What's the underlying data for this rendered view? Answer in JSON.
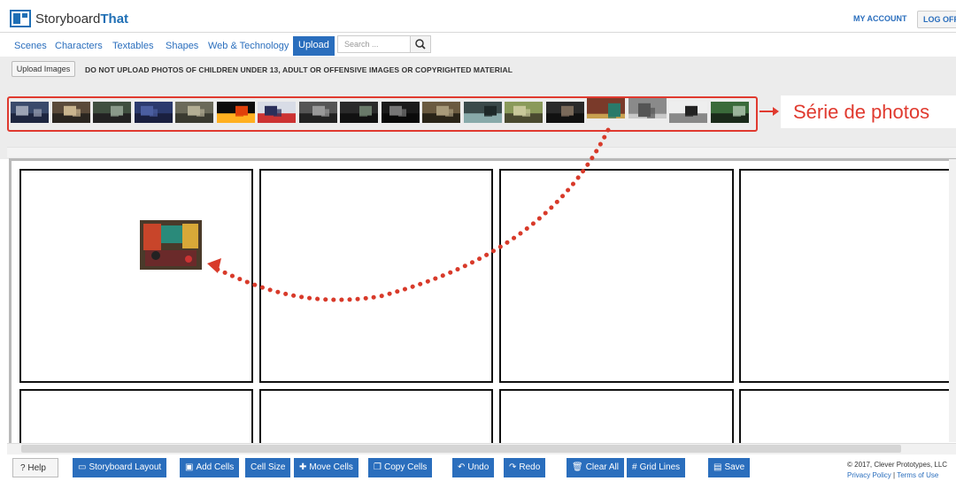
{
  "brand": {
    "name_part1": "Storyboard",
    "name_part2": "That"
  },
  "header": {
    "my_account": "MY ACCOUNT",
    "log_off": "LOG OFF"
  },
  "tabs": [
    {
      "label": "Scenes"
    },
    {
      "label": "Characters"
    },
    {
      "label": "Textables"
    },
    {
      "label": "Shapes"
    },
    {
      "label": "Web & Technology"
    },
    {
      "label": "Upload",
      "active": true
    }
  ],
  "search": {
    "placeholder": "Search ..."
  },
  "upload": {
    "button_label": "Upload Images",
    "warning": "DO NOT UPLOAD PHOTOS OF CHILDREN UNDER 13, ADULT OR OFFENSIVE IMAGES OR COPYRIGHTED MATERIAL"
  },
  "thumbnails": [
    {
      "colors": [
        "#3a4a6b",
        "#9ca3b5",
        "#1e2640"
      ]
    },
    {
      "colors": [
        "#5a4a3a",
        "#c9b48e",
        "#2a2520"
      ]
    },
    {
      "colors": [
        "#3f4f3f",
        "#8a9a8a",
        "#222"
      ]
    },
    {
      "colors": [
        "#2b3a6e",
        "#4b5ea0",
        "#1a2040"
      ]
    },
    {
      "colors": [
        "#6b6a5a",
        "#b3ae94",
        "#3a3a30"
      ]
    },
    {
      "colors": [
        "#0c0c0c",
        "#e0400a",
        "#ffb020"
      ]
    },
    {
      "colors": [
        "#d8dce6",
        "#2b2f5a",
        "#c33"
      ]
    },
    {
      "colors": [
        "#555",
        "#999",
        "#222"
      ]
    },
    {
      "colors": [
        "#2a2a2a",
        "#6a7a6a",
        "#111"
      ]
    },
    {
      "colors": [
        "#1b1b1b",
        "#777",
        "#0a0a0a"
      ]
    },
    {
      "colors": [
        "#6a5a40",
        "#a89a7a",
        "#2a2418"
      ]
    },
    {
      "colors": [
        "#3a4a4a",
        "#1e2a2a",
        "#8aa"
      ]
    },
    {
      "colors": [
        "#8a9a5a",
        "#c8c89a",
        "#4a4a30"
      ]
    },
    {
      "colors": [
        "#2a2a2a",
        "#7a6a5a",
        "#111"
      ]
    },
    {
      "colors": [
        "#7a3a2a",
        "#2a7a6a",
        "#c8a050"
      ]
    },
    {
      "colors": [
        "#8a8a8a",
        "#555",
        "#c8c8c8"
      ]
    },
    {
      "colors": [
        "#eee",
        "#222",
        "#888"
      ]
    },
    {
      "colors": [
        "#3a6a3a",
        "#9ab59a",
        "#1a2a1a"
      ]
    }
  ],
  "callout": {
    "text": "Série de photos",
    "color": "#e03a2f"
  },
  "toolbar": {
    "help": "Help",
    "storyboard_layout": "Storyboard Layout",
    "add_cells": "Add Cells",
    "cell_size": "Cell Size",
    "move_cells": "Move Cells",
    "copy_cells": "Copy Cells",
    "undo": "Undo",
    "redo": "Redo",
    "clear_all": "Clear All",
    "grid_lines": "Grid Lines",
    "save": "Save"
  },
  "footer": {
    "copyright": "© 2017, Clever Prototypes, LLC",
    "privacy": "Privacy Policy",
    "separator": "|",
    "terms": "Terms of Use"
  },
  "accent_color": "#2a6ebd"
}
